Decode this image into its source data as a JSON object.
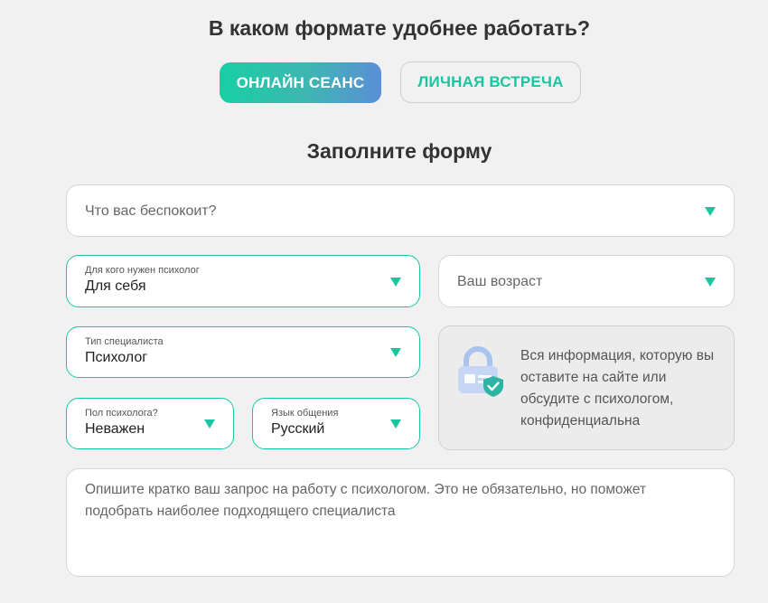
{
  "header": {
    "title": "В каком формате удобнее работать?",
    "format_buttons": [
      {
        "label": "ОНЛАЙН СЕАНС",
        "selected": true
      },
      {
        "label": "ЛИЧНАЯ ВСТРЕЧА",
        "selected": false
      }
    ]
  },
  "form": {
    "title": "Заполните форму",
    "concern": {
      "placeholder": "Что вас беспокоит?"
    },
    "for_whom": {
      "label": "Для кого нужен психолог",
      "value": "Для себя"
    },
    "age": {
      "placeholder": "Ваш возраст"
    },
    "specialist_type": {
      "label": "Тип специалиста",
      "value": "Психолог"
    },
    "gender": {
      "label": "Пол психолога?",
      "value": "Неважен"
    },
    "language": {
      "label": "Язык общения",
      "value": "Русский"
    },
    "privacy_note": "Вся информация, которую вы оставите на сайте или обсудите с психологом, конфиденциальна",
    "request": {
      "placeholder": "Опишите кратко ваш запрос на работу с психологом. Это не обязательно, но поможет подобрать наиболее подходящего специалиста"
    }
  },
  "colors": {
    "accent": "#19c6a0",
    "gradient_start": "#17cfa3",
    "gradient_end": "#5a8fd8",
    "background": "#f1f1f1"
  },
  "icons": {
    "dropdown": "caret-down-icon",
    "privacy": "lock-shield-icon"
  }
}
